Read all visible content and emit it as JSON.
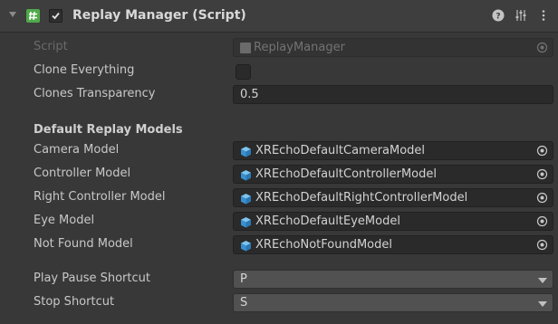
{
  "component": {
    "title": "Replay Manager (Script)",
    "enabled": true
  },
  "header_icons": {
    "foldout": "foldout-triangle-icon",
    "script": "script-hash-icon",
    "help": "help-icon",
    "presets": "presets-icon",
    "menu": "kebab-menu-icon"
  },
  "fields": {
    "script": {
      "label": "Script",
      "value": "ReplayManager"
    },
    "clone_everything": {
      "label": "Clone Everything",
      "checked": false
    },
    "clones_transparency": {
      "label": "Clones Transparency",
      "value": "0.5"
    }
  },
  "section": {
    "title": "Default Replay Models"
  },
  "models": [
    {
      "label": "Camera Model",
      "value": "XREchoDefaultCameraModel"
    },
    {
      "label": "Controller Model",
      "value": "XREchoDefaultControllerModel"
    },
    {
      "label": "Right Controller Model",
      "value": "XREchoDefaultRightControllerModel"
    },
    {
      "label": "Eye Model",
      "value": "XREchoDefaultEyeModel"
    },
    {
      "label": "Not Found Model",
      "value": "XREchoNotFoundModel"
    }
  ],
  "shortcuts": {
    "play_pause": {
      "label": "Play Pause Shortcut",
      "value": "P"
    },
    "stop": {
      "label": "Stop Shortcut",
      "value": "S"
    }
  },
  "colors": {
    "background": "#383838",
    "header": "#3e3e3e",
    "field": "#2a2a2a",
    "dropdown": "#515151",
    "prefab_icon": "#4aa3df",
    "script_icon": "#4fa94a"
  }
}
